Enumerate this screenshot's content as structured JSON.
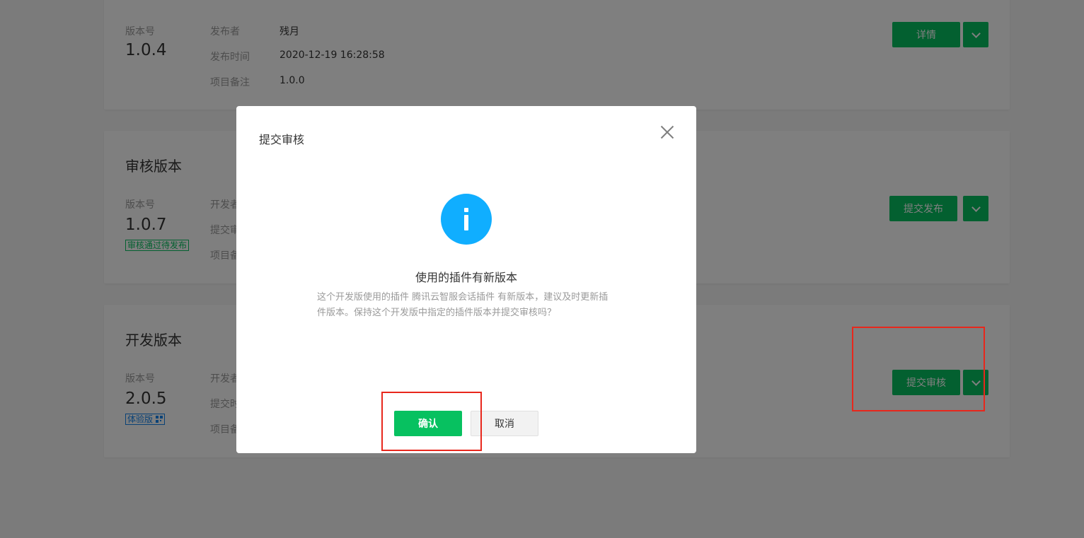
{
  "online_version": {
    "version_label": "版本号",
    "version_number": "1.0.4",
    "info": [
      {
        "key": "发布者",
        "value": "残月"
      },
      {
        "key": "发布时间",
        "value": "2020-12-19 16:28:58"
      },
      {
        "key": "项目备注",
        "value": "1.0.0"
      }
    ],
    "primary_button": "详情"
  },
  "review_version": {
    "title": "审核版本",
    "version_label": "版本号",
    "version_number": "1.0.7",
    "status_tag": "审核通过待发布",
    "info_keys": [
      "开发者",
      "提交审",
      "项目备"
    ],
    "primary_button": "提交发布"
  },
  "dev_version": {
    "title": "开发版本",
    "version_label": "版本号",
    "version_number": "2.0.5",
    "status_tag": "体验版",
    "info_keys": [
      "开发者",
      "提交时",
      "项目备"
    ],
    "primary_button": "提交审核"
  },
  "dialog": {
    "title": "提交审核",
    "heading": "使用的插件有新版本",
    "description": "这个开发版使用的插件 腾讯云智服会话插件 有新版本，建议及时更新插件版本。保持这个开发版中指定的插件版本并提交审核吗？",
    "confirm_label": "确认",
    "cancel_label": "取消"
  },
  "colors": {
    "brand_green": "#07c160",
    "info_blue": "#10aeff",
    "highlight_red": "#e8271c"
  },
  "icons": [
    "close-icon",
    "info-icon",
    "chevron-down-icon",
    "qrcode-icon"
  ]
}
